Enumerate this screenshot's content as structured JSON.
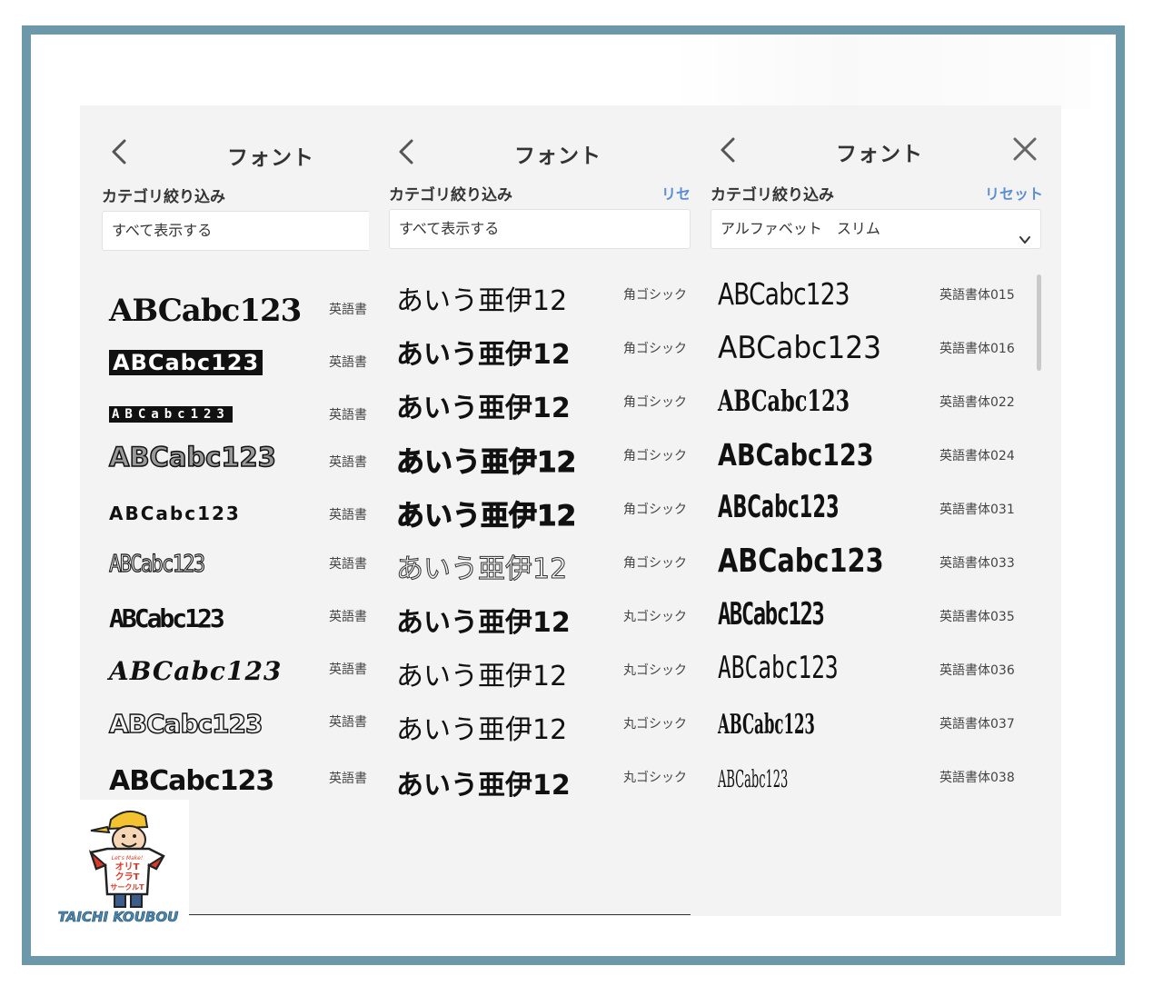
{
  "panels": [
    {
      "title": "フォント",
      "filter_label": "カテゴリ絞り込み",
      "reset_label": "",
      "select_value": "すべて表示する",
      "rows": [
        {
          "sample": "ABCabc123",
          "category": "英語書"
        },
        {
          "sample": "ABCabc123",
          "category": "英語書"
        },
        {
          "sample": "ABCabc123",
          "category": "英語書"
        },
        {
          "sample": "ABCabc123",
          "category": "英語書"
        },
        {
          "sample": "ABCabc123",
          "category": "英語書"
        },
        {
          "sample": "ABCabc123",
          "category": "英語書"
        },
        {
          "sample": "ABCabc123",
          "category": "英語書"
        },
        {
          "sample": "ABCabc123",
          "category": "英語書"
        },
        {
          "sample": "ABCabc123",
          "category": "英語書"
        },
        {
          "sample": "ABCabc123",
          "category": "英語書"
        }
      ]
    },
    {
      "title": "フォント",
      "filter_label": "カテゴリ絞り込み",
      "reset_label": "リセ",
      "select_value": "すべて表示する",
      "rows": [
        {
          "sample": "あいう亜伊12",
          "category": "角ゴシック"
        },
        {
          "sample": "あいう亜伊12",
          "category": "角ゴシック"
        },
        {
          "sample": "あいう亜伊12",
          "category": "角ゴシック"
        },
        {
          "sample": "あいう亜伊12",
          "category": "角ゴシック"
        },
        {
          "sample": "あいう亜伊12",
          "category": "角ゴシック"
        },
        {
          "sample": "あいう亜伊12",
          "category": "角ゴシック"
        },
        {
          "sample": "あいう亜伊12",
          "category": "丸ゴシック"
        },
        {
          "sample": "あいう亜伊12",
          "category": "丸ゴシック"
        },
        {
          "sample": "あいう亜伊12",
          "category": "丸ゴシック"
        },
        {
          "sample": "あいう亜伊12",
          "category": "丸ゴシック"
        }
      ]
    },
    {
      "title": "フォント",
      "filter_label": "カテゴリ絞り込み",
      "reset_label": "リセット",
      "select_value": "アルファベット　スリム",
      "rows": [
        {
          "sample": "ABCabc123",
          "category": "英語書体015"
        },
        {
          "sample": "ABCabc123",
          "category": "英語書体016"
        },
        {
          "sample": "ABCabc123",
          "category": "英語書体022"
        },
        {
          "sample": "ABCabc123",
          "category": "英語書体024"
        },
        {
          "sample": "ABCabc123",
          "category": "英語書体031"
        },
        {
          "sample": "ABCabc123",
          "category": "英語書体033"
        },
        {
          "sample": "ABCabc123",
          "category": "英語書体035"
        },
        {
          "sample": "ABCabc123",
          "category": "英語書体036"
        },
        {
          "sample": "ABCabc123",
          "category": "英語書体037"
        },
        {
          "sample": "ABCabc123",
          "category": "英語書体038"
        }
      ]
    }
  ],
  "logo": {
    "shirt_tagline": "Let's Make!",
    "shirt_lines": [
      "オリT",
      "クラT",
      "サークルT"
    ],
    "brand": "TAICHI KOUBOU"
  },
  "colors": {
    "frame": "#6c98aa",
    "panel_bg": "#f3f3f3",
    "reset_link": "#5b8fd0",
    "logo_red": "#d93a2b",
    "logo_yellow": "#f2c230"
  }
}
